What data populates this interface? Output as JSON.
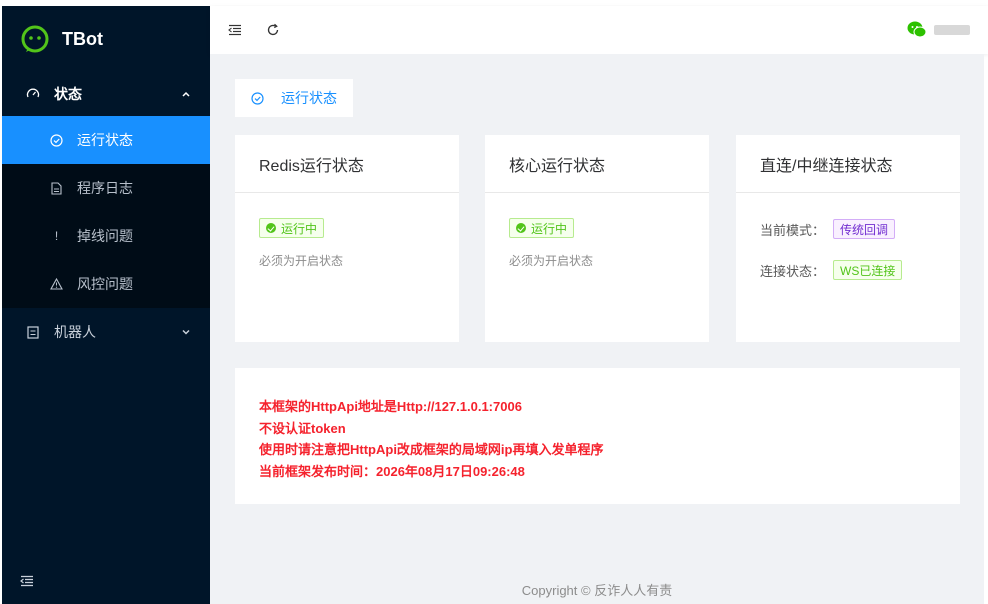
{
  "app": {
    "title": "TBot"
  },
  "sidebar": {
    "groups": [
      {
        "label": "状态",
        "icon": "dashboard-icon",
        "expanded": true,
        "items": [
          {
            "label": "运行状态",
            "icon": "check-circle-icon",
            "active": true
          },
          {
            "label": "程序日志",
            "icon": "file-icon",
            "active": false
          },
          {
            "label": "掉线问题",
            "icon": "exclamation-icon",
            "active": false
          },
          {
            "label": "风控问题",
            "icon": "warning-icon",
            "active": false
          }
        ]
      },
      {
        "label": "机器人",
        "icon": "robot-icon",
        "expanded": false
      }
    ]
  },
  "tabs": [
    {
      "label": "运行状态",
      "icon": "check-circle-icon"
    }
  ],
  "cards": {
    "redis": {
      "title": "Redis运行状态",
      "status": "运行中",
      "hint": "必须为开启状态"
    },
    "core": {
      "title": "核心运行状态",
      "status": "运行中",
      "hint": "必须为开启状态"
    },
    "connection": {
      "title": "直连/中继连接状态",
      "mode_label": "当前模式：",
      "mode_value": "传统回调",
      "conn_label": "连接状态：",
      "conn_value": "WS已连接"
    }
  },
  "info": {
    "lines": [
      "本框架的HttpApi地址是Http://127.1.0.1:7006",
      "不设认证token",
      "使用时请注意把HttpApi改成框架的局域网ip再填入发单程序",
      "当前框架发布时间：2026年08月17日09:26:48"
    ]
  },
  "footer": {
    "text": "Copyright © 反诈人人有责"
  },
  "colors": {
    "sidebar_bg": "#001529",
    "accent": "#1890ff",
    "success": "#52c41a",
    "danger": "#f5222d",
    "purple": "#722ed1"
  }
}
